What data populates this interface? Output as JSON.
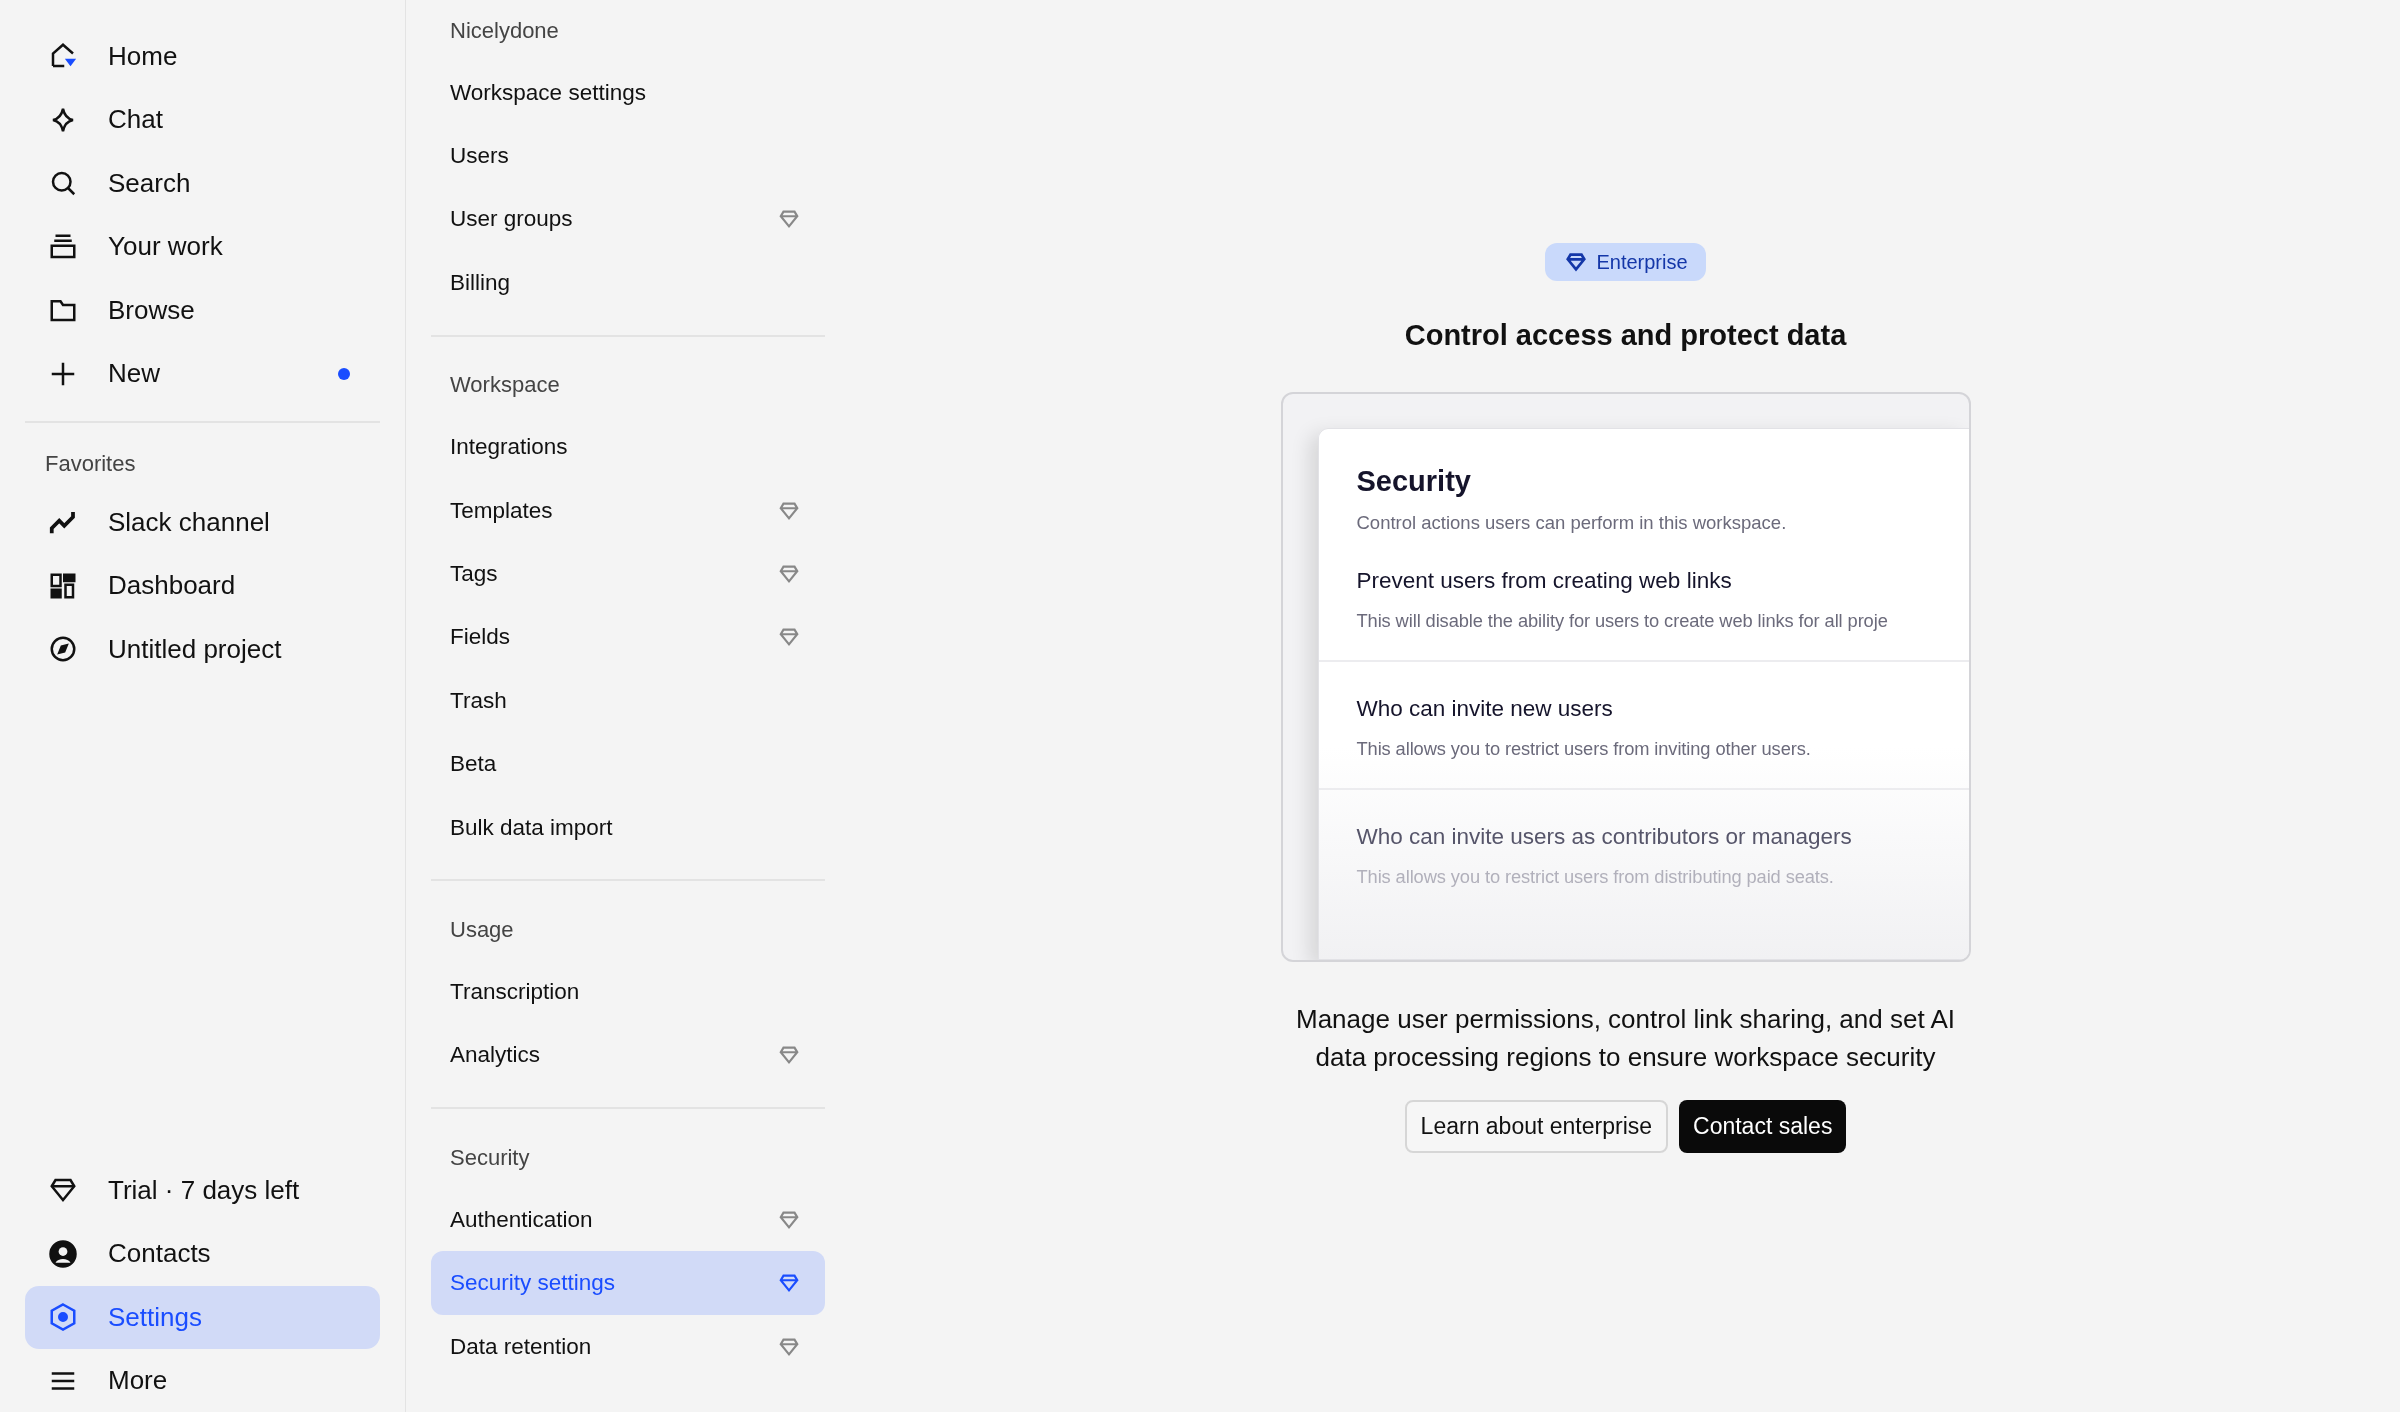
{
  "sidebar": {
    "nav": [
      {
        "label": "Home",
        "selected": false,
        "dot": false
      },
      {
        "label": "Chat",
        "selected": false,
        "dot": false
      },
      {
        "label": "Search",
        "selected": false,
        "dot": false
      },
      {
        "label": "Your work",
        "selected": false,
        "dot": false
      },
      {
        "label": "Browse",
        "selected": false,
        "dot": false
      },
      {
        "label": "New",
        "selected": false,
        "dot": true
      }
    ],
    "favorites": {
      "title": "Favorites",
      "items": [
        {
          "label": "Slack channel",
          "selected": false
        },
        {
          "label": "Dashboard",
          "selected": false
        },
        {
          "label": "Untitled project",
          "selected": false
        }
      ]
    },
    "bottom": [
      {
        "label": "Trial · 7 days left",
        "selected": false
      },
      {
        "label": "Contacts",
        "selected": false
      },
      {
        "label": "Settings",
        "selected": true
      },
      {
        "label": "More",
        "selected": false
      }
    ]
  },
  "settings_menu": [
    {
      "title": "Nicelydone",
      "items": [
        {
          "label": "Workspace settings",
          "premium": false,
          "selected": false
        },
        {
          "label": "Users",
          "premium": false,
          "selected": false
        },
        {
          "label": "User groups",
          "premium": true,
          "selected": false
        },
        {
          "label": "Billing",
          "premium": false,
          "selected": false
        }
      ]
    },
    {
      "title": "Workspace",
      "items": [
        {
          "label": "Integrations",
          "premium": false,
          "selected": false
        },
        {
          "label": "Templates",
          "premium": true,
          "selected": false
        },
        {
          "label": "Tags",
          "premium": true,
          "selected": false
        },
        {
          "label": "Fields",
          "premium": true,
          "selected": false
        },
        {
          "label": "Trash",
          "premium": false,
          "selected": false
        },
        {
          "label": "Beta",
          "premium": false,
          "selected": false
        },
        {
          "label": "Bulk data import",
          "premium": false,
          "selected": false
        }
      ]
    },
    {
      "title": "Usage",
      "items": [
        {
          "label": "Transcription",
          "premium": false,
          "selected": false
        },
        {
          "label": "Analytics",
          "premium": true,
          "selected": false
        }
      ]
    },
    {
      "title": "Security",
      "items": [
        {
          "label": "Authentication",
          "premium": true,
          "selected": false
        },
        {
          "label": "Security settings",
          "premium": true,
          "selected": true
        },
        {
          "label": "Data retention",
          "premium": true,
          "selected": false
        }
      ]
    }
  ],
  "main": {
    "badge": "Enterprise",
    "title": "Control access and protect data",
    "preview": {
      "title": "Security",
      "subtitle": "Control actions users can perform in this workspace.",
      "sections": [
        {
          "title": "Prevent users from creating web links",
          "description": "This will disable the ability for users to create web links for all proje",
          "faded": false
        },
        {
          "title": "Who can invite new users",
          "description": "This allows you to restrict users from inviting other users.",
          "faded": false
        },
        {
          "title": "Who can invite users as contributors or managers",
          "description": "This allows you to restrict users from distributing paid seats.",
          "faded": true
        }
      ]
    },
    "description": "Manage user permissions, control link sharing, and set AI data processing regions to ensure workspace security",
    "buttons": [
      {
        "label": "Learn about enterprise",
        "kind": "secondary"
      },
      {
        "label": "Contact sales",
        "kind": "primary"
      }
    ]
  }
}
